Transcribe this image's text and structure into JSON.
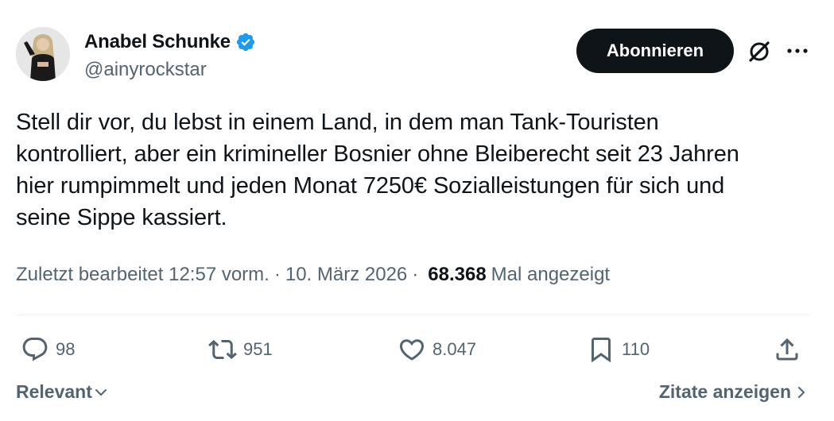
{
  "author": {
    "display_name": "Anabel Schunke",
    "handle": "@ainyrockstar",
    "verified_color": "#1d9bf0"
  },
  "header": {
    "follow_label": "Abonnieren",
    "grok_icon": "grok-icon",
    "more_icon": "more-icon"
  },
  "tweet": {
    "text": "Stell dir vor, du lebst in einem Land, in dem man Tank-Touristen\nkontrolliert, aber ein krimineller Bosnier ohne Bleiberecht seit 23 Jahren\nhier rumpimmelt und jeden Monat 7250€ Sozialleistungen für sich und\nseine Sippe kassiert."
  },
  "meta": {
    "edited": "Zuletzt bearbeitet 12:57 vorm.",
    "separator": "·",
    "date": "10. März 2026",
    "views_count": "68.368",
    "views_label": "Mal angezeigt"
  },
  "actions": {
    "replies": "98",
    "reposts": "951",
    "likes": "8.047",
    "bookmarks": "110"
  },
  "footer": {
    "sort_label": "Relevant",
    "quotes_label": "Zitate anzeigen"
  },
  "colors": {
    "text": "#0f1419",
    "secondary": "#536471",
    "button_bg": "#0f1419",
    "verified": "#1d9bf0"
  }
}
